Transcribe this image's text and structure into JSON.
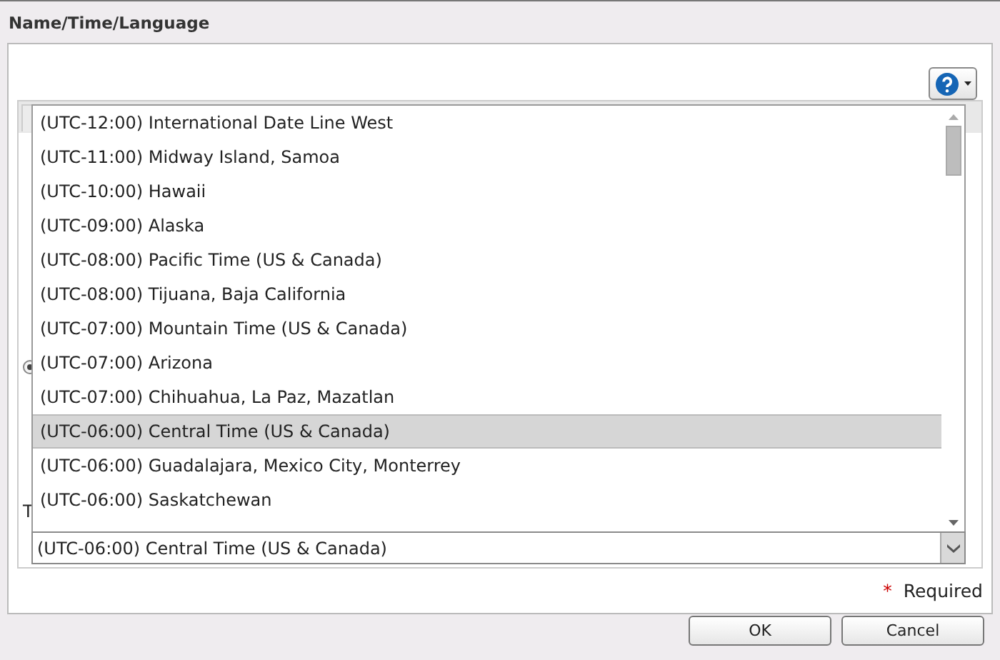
{
  "window": {
    "title": "Name/Time/Language"
  },
  "background_form": {
    "label": "T",
    "radio": {
      "selected": true
    }
  },
  "timezone_select": {
    "value": "(UTC-06:00) Central Time (US & Canada)",
    "options": [
      {
        "label": "(UTC-12:00) International Date Line West",
        "selected": false
      },
      {
        "label": "(UTC-11:00) Midway Island, Samoa",
        "selected": false
      },
      {
        "label": "(UTC-10:00) Hawaii",
        "selected": false
      },
      {
        "label": "(UTC-09:00) Alaska",
        "selected": false
      },
      {
        "label": "(UTC-08:00) Pacific Time (US & Canada)",
        "selected": false
      },
      {
        "label": "(UTC-08:00) Tijuana, Baja California",
        "selected": false
      },
      {
        "label": "(UTC-07:00) Mountain Time (US & Canada)",
        "selected": false
      },
      {
        "label": "(UTC-07:00) Arizona",
        "selected": false
      },
      {
        "label": "(UTC-07:00) Chihuahua, La Paz, Mazatlan",
        "selected": false
      },
      {
        "label": "(UTC-06:00) Central Time (US & Canada)",
        "selected": true
      },
      {
        "label": "(UTC-06:00) Guadalajara, Mexico City, Monterrey",
        "selected": false
      },
      {
        "label": "(UTC-06:00) Saskatchewan",
        "selected": false
      }
    ]
  },
  "required_note": {
    "mark": "*",
    "label": "Required"
  },
  "buttons": [
    "OK",
    "Cancel"
  ]
}
